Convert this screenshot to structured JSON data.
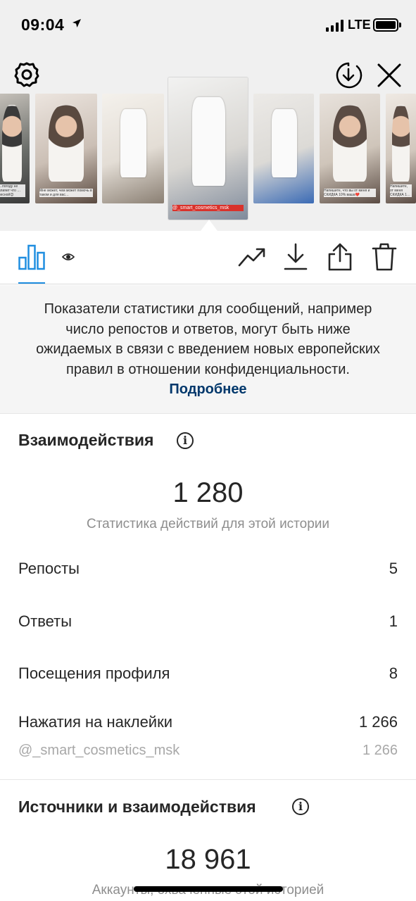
{
  "status_bar": {
    "time": "09:04",
    "network": "LTE",
    "battery_level": 1.0
  },
  "header": {
    "icons": {
      "settings": "gear-icon",
      "download": "download-circle-icon",
      "close": "close-icon"
    }
  },
  "thumbnails": [
    {
      "colors": [
        "#6b6e6a",
        "#c7c2bb",
        "#3a3a3a"
      ],
      "caption": "…погоду не влияет что …весной😊",
      "selected": false
    },
    {
      "colors": [
        "#cbbfb5",
        "#ece5df",
        "#5a4a40"
      ],
      "caption": "Мне может, чем может помочь в таком и для вас…",
      "selected": false
    },
    {
      "colors": [
        "#e3ddd5",
        "#f4f1ec",
        "#8a7f73"
      ],
      "caption": "",
      "selected": false
    },
    {
      "colors": [
        "#d8d6d2",
        "#f2f2f1",
        "#7f8a9b"
      ],
      "caption": "@_smart_cosmetics_msk",
      "selected": true
    },
    {
      "colors": [
        "#dcdad6",
        "#eceae7",
        "#3b6bb5"
      ],
      "caption": "",
      "selected": false
    },
    {
      "colors": [
        "#cfc5ba",
        "#e8e2dc",
        "#5b4c44"
      ],
      "caption": "Напишите, что вы от меня и СКИДКА 10% ваша❤️",
      "selected": false
    },
    {
      "colors": [
        "#d2c8be",
        "#efe9e3",
        "#5b4c44"
      ],
      "caption": "Напишите, от меня СКИДКА 1…",
      "selected": false
    }
  ],
  "tabs": {
    "insights": "bar-chart-icon",
    "viewers": "eye-icon",
    "promote": "trending-up-icon",
    "save": "download-icon",
    "share": "share-icon",
    "delete": "trash-icon"
  },
  "notice": {
    "text": "Показатели статистики для сообщений, например число репостов и ответов, могут быть ниже ожидаемых в связи с введением новых европейских правил в отношении конфиденциальности.",
    "link": "Подробнее"
  },
  "interactions": {
    "title": "Взаимодействия",
    "total": "1 280",
    "caption": "Статистика действий для этой истории",
    "rows": [
      {
        "label": "Репосты",
        "value": "5"
      },
      {
        "label": "Ответы",
        "value": "1"
      },
      {
        "label": "Посещения профиля",
        "value": "8"
      },
      {
        "label": "Нажатия на наклейки",
        "value": "1 266"
      }
    ],
    "sub_row": {
      "label": "@_smart_cosmetics_msk",
      "value": "1 266"
    }
  },
  "discovery": {
    "title": "Источники и взаимодействия",
    "total": "18 961",
    "caption": "Аккаунты, охваченные этой историей"
  },
  "colors": {
    "link": "#00376b",
    "text": "#262626",
    "muted": "#8e8e8e"
  }
}
